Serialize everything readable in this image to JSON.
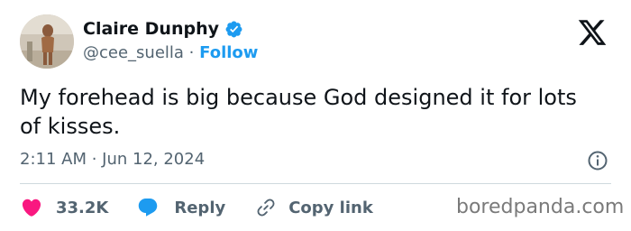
{
  "author": {
    "display_name": "Claire Dunphy",
    "handle": "@cee_suella",
    "separator": "·",
    "follow_label": "Follow",
    "verified_color": "#1d9bf0"
  },
  "tweet": {
    "text": "My forehead is big because God designed it for lots of kisses.",
    "timestamp": "2:11 AM · Jun 12, 2024"
  },
  "actions": {
    "like_count": "33.2K",
    "like_color": "#f91880",
    "reply_label": "Reply",
    "reply_color": "#1d9bf0",
    "copy_link_label": "Copy link"
  },
  "watermark": "boredpanda.com",
  "icons": {
    "platform": "x-logo-icon",
    "info": "info-icon",
    "like": "heart-icon",
    "reply": "reply-bubble-icon",
    "copy_link": "link-icon",
    "verified": "verified-badge-icon"
  }
}
